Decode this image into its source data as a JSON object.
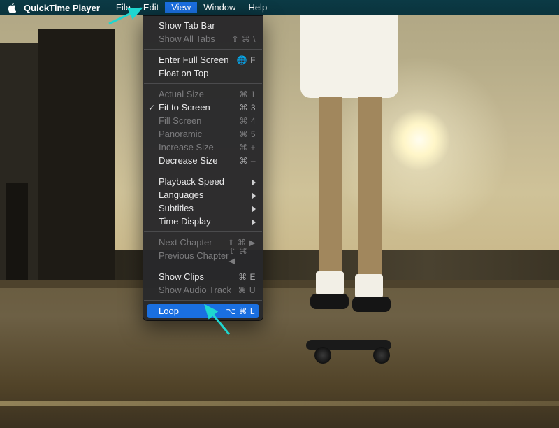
{
  "menubar": {
    "app_name": "QuickTime Player",
    "items": [
      "File",
      "Edit",
      "View",
      "Window",
      "Help"
    ],
    "open_index": 2
  },
  "view_menu": {
    "groups": [
      [
        {
          "label": "Show Tab Bar",
          "enabled": true
        },
        {
          "label": "Show All Tabs",
          "enabled": false,
          "accel": "⇧ ⌘ \\"
        }
      ],
      [
        {
          "label": "Enter Full Screen",
          "enabled": true,
          "accel": "🌐 F"
        },
        {
          "label": "Float on Top",
          "enabled": true
        }
      ],
      [
        {
          "label": "Actual Size",
          "enabled": false,
          "accel": "⌘ 1"
        },
        {
          "label": "Fit to Screen",
          "enabled": true,
          "checked": true,
          "accel": "⌘ 3"
        },
        {
          "label": "Fill Screen",
          "enabled": false,
          "accel": "⌘ 4"
        },
        {
          "label": "Panoramic",
          "enabled": false,
          "accel": "⌘ 5"
        },
        {
          "label": "Increase Size",
          "enabled": false,
          "accel": "⌘ +"
        },
        {
          "label": "Decrease Size",
          "enabled": true,
          "accel": "⌘ –"
        }
      ],
      [
        {
          "label": "Playback Speed",
          "enabled": true,
          "submenu": true
        },
        {
          "label": "Languages",
          "enabled": true,
          "submenu": true
        },
        {
          "label": "Subtitles",
          "enabled": true,
          "submenu": true
        },
        {
          "label": "Time Display",
          "enabled": true,
          "submenu": true
        }
      ],
      [
        {
          "label": "Next Chapter",
          "enabled": false,
          "accel": "⇧ ⌘ ▶"
        },
        {
          "label": "Previous Chapter",
          "enabled": false,
          "accel": "⇧ ⌘ ◀"
        }
      ],
      [
        {
          "label": "Show Clips",
          "enabled": true,
          "accel": "⌘ E"
        },
        {
          "label": "Show Audio Track",
          "enabled": false,
          "accel": "⌘ U"
        }
      ],
      [
        {
          "label": "Loop",
          "enabled": true,
          "highlight": true,
          "accel": "⌥ ⌘ L"
        }
      ]
    ]
  },
  "annotation": {
    "color": "#1fd6d0"
  }
}
